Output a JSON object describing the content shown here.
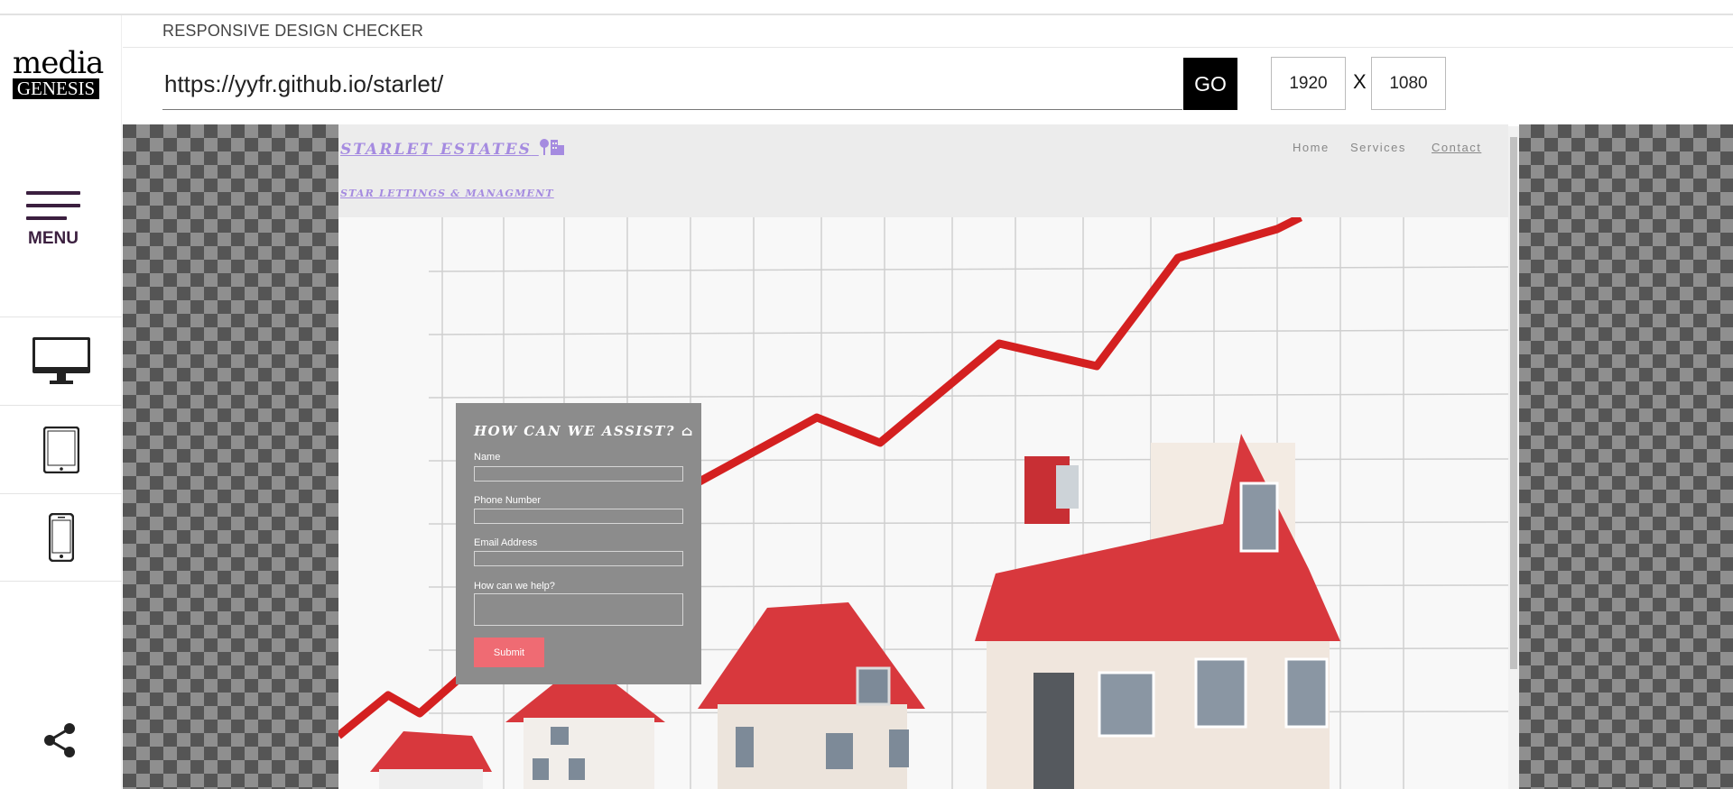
{
  "app": {
    "title": "RESPONSIVE DESIGN CHECKER",
    "logo_top": "media",
    "logo_bottom": "GENESIS",
    "menu_label": "MENU"
  },
  "toolbar": {
    "url": "https://yyfr.github.io/starlet/",
    "go_label": "GO",
    "width": "1920",
    "x_label": "X",
    "height": "1080"
  },
  "sidebar": {
    "devices": [
      {
        "name": "desktop-icon"
      },
      {
        "name": "tablet-icon"
      },
      {
        "name": "mobile-icon"
      }
    ],
    "share_icon": "share-icon"
  },
  "site": {
    "brand": "STARLET ESTATES",
    "tagline": "STAR LETTINGS & MANAGMENT",
    "nav": [
      "Home",
      "Services",
      "Contact"
    ],
    "form": {
      "title": "HOW CAN WE ASSIST?",
      "name_label": "Name",
      "phone_label": "Phone Number",
      "email_label": "Email Address",
      "help_label": "How can we help?",
      "submit_label": "Submit"
    }
  },
  "colors": {
    "brand_purple": "#a58be0",
    "menu_purple": "#3b1f3f",
    "submit_red": "#ef6b73",
    "roof_red": "#d8383d"
  }
}
